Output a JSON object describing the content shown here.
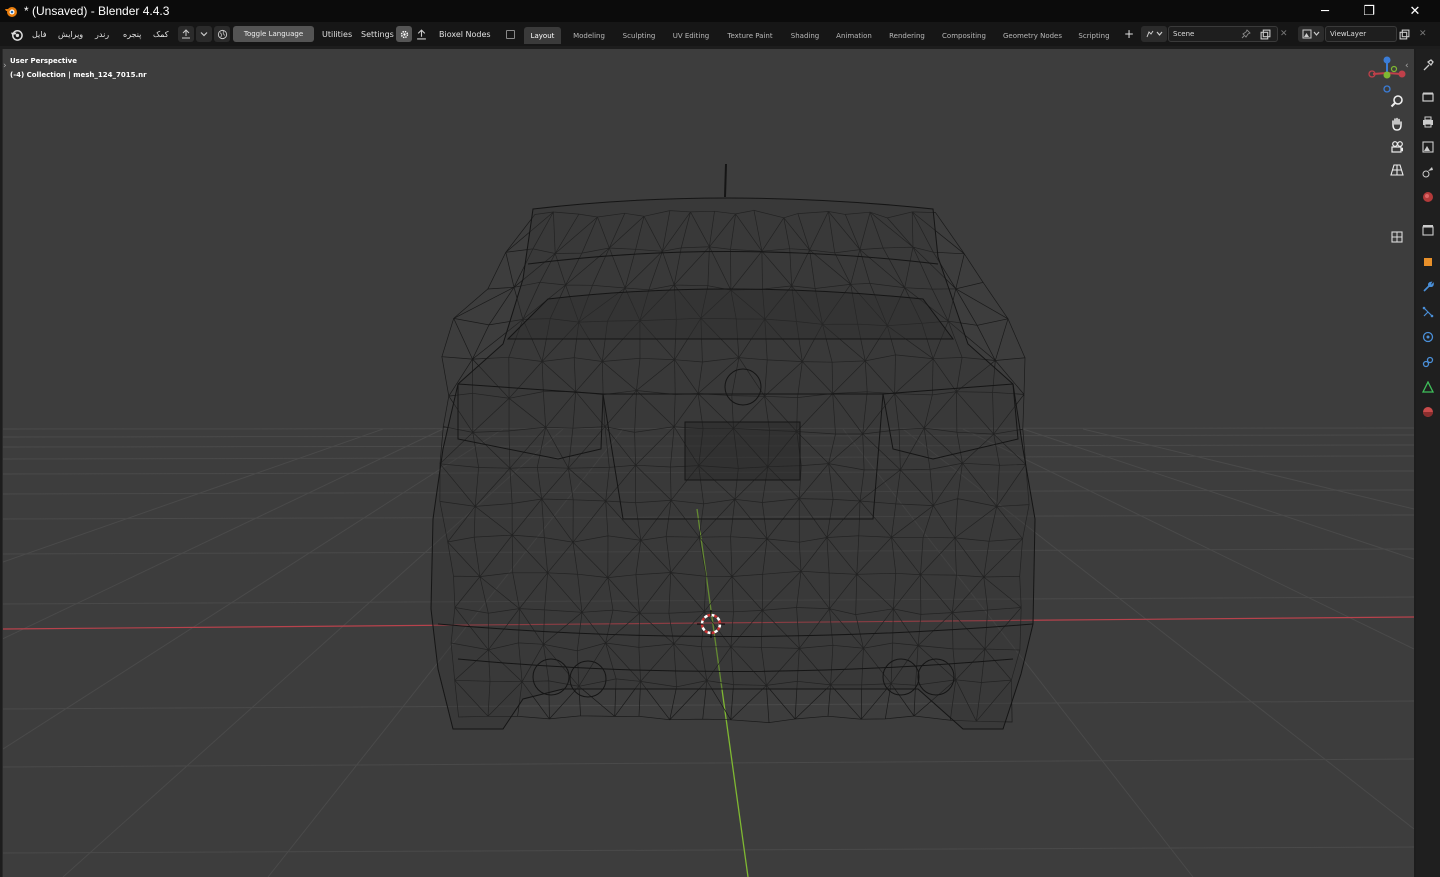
{
  "window": {
    "title": "* (Unsaved) - Blender 4.4.3",
    "controls": {
      "minimize": "─",
      "restore": "❐",
      "close": "✕"
    }
  },
  "menubar": {
    "menus": [
      "فایل",
      "ویرایش",
      "رندر",
      "پنجره",
      "کمک"
    ],
    "toggle_language": "Toggle Language",
    "utilities": "Utilities",
    "settings": "Settings",
    "bioxel_nodes": "Bioxel Nodes"
  },
  "workspaces": {
    "tabs": [
      "Layout",
      "Modeling",
      "Sculpting",
      "UV Editing",
      "Texture Paint",
      "Shading",
      "Animation",
      "Rendering",
      "Compositing",
      "Geometry Nodes",
      "Scripting"
    ],
    "active": "Layout",
    "add": "+"
  },
  "scene": {
    "name": "Scene",
    "view_layer": "ViewLayer"
  },
  "viewport": {
    "view_name": "User Perspective",
    "collection_info": "(-4) Collection | mesh_124_7015.nr"
  },
  "icons": {
    "blender_logo": "blender-logo-icon",
    "zoom": "zoom-icon",
    "pan": "hand-icon",
    "camera": "camera-view-icon",
    "ortho": "grid-ortho-icon"
  },
  "colors": {
    "accent": "#4772b3",
    "x_axis": "#c0404a",
    "y_axis": "#7fb832",
    "z_axis": "#3b7dd8",
    "viewport_bg": "#3d3d3d"
  }
}
